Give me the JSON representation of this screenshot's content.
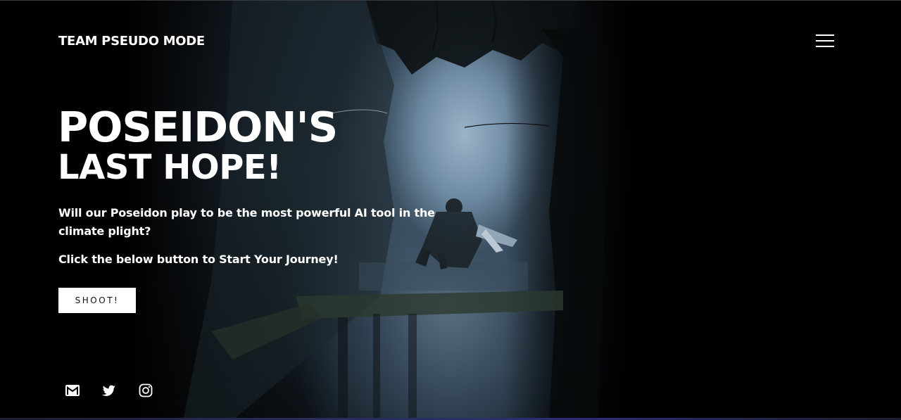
{
  "header": {
    "brand": "TEAM PSEUDO MODE",
    "menu_icon": "hamburger-menu-icon"
  },
  "hero": {
    "title_line1": "POSEIDON'S",
    "title_line2": "LAST HOPE!",
    "subtitle": "Will our Poseidon play to be the most powerful AI tool in the climate plight?",
    "cta_text": "Click the below button to Start Your Journey!",
    "button_label": "SHOOT!"
  },
  "social": {
    "items": [
      {
        "icon": "gmail-icon"
      },
      {
        "icon": "twitter-icon"
      },
      {
        "icon": "instagram-icon"
      }
    ]
  },
  "colors": {
    "background": "#000000",
    "text": "#ffffff",
    "button_bg": "#ffffff",
    "button_text": "#111111"
  }
}
